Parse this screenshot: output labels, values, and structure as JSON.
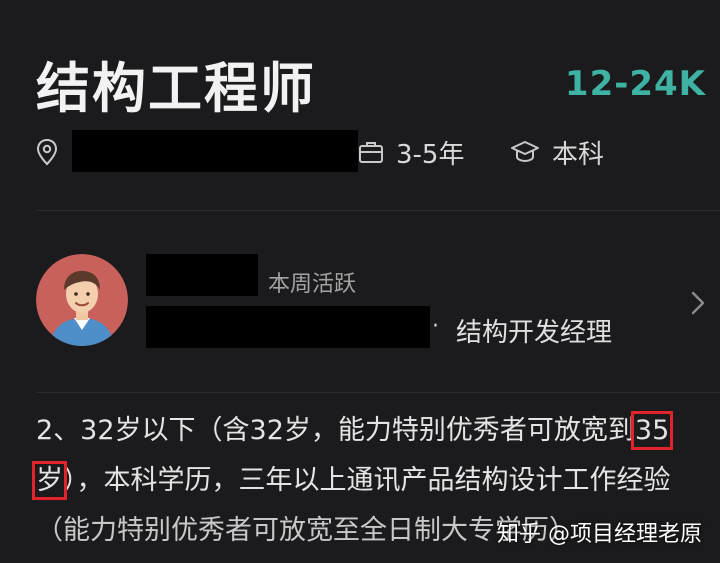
{
  "job": {
    "title": "结构工程师",
    "salary": "12-24K",
    "experience": "3-5年",
    "education": "本科"
  },
  "profile": {
    "active_status": "本周活跃",
    "separator": "·",
    "role": "结构开发经理"
  },
  "description": {
    "line1_pre": "2、32岁以下（含32岁，能力特别优秀者可放宽到",
    "line1_hl": "35",
    "line2_hl": "岁",
    "line2_post": "），本科学历，三年以上通讯产品结构设计工作经验",
    "line3": "（能力特别优秀者可放宽至全日制大专学历）"
  },
  "watermark": "知乎 @项目经理老原",
  "colors": {
    "background": "#1b1b1d",
    "salary": "#3fb3a3",
    "highlight_box": "#e0242a",
    "avatar_bg": "#c8605b"
  },
  "icons": [
    "location-pin-icon",
    "briefcase-icon",
    "graduation-cap-icon",
    "chevron-right-icon"
  ]
}
